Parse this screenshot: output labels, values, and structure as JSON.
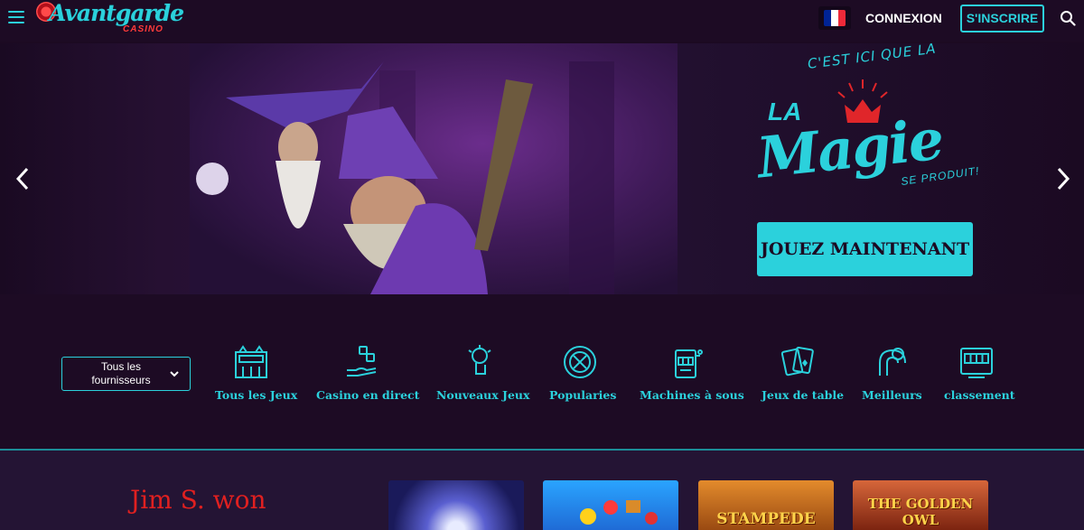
{
  "header": {
    "logo_text": "Avantgarde",
    "logo_sub": "CASINO",
    "login_label": "CONNEXION",
    "signup_label": "S'INSCRIRE",
    "flag_colors": [
      "#002395",
      "#ffffff",
      "#ed2939"
    ]
  },
  "hero": {
    "tagline": "C'EST ICI QUE LA",
    "la": "LA",
    "magie": "Magie",
    "produit": "SE PRODUIT!",
    "cta_label": "JOUEZ MAINTENANT",
    "accent": "#2bd1dc"
  },
  "filters": {
    "provider_label": "Tous les fournisseurs"
  },
  "categories": [
    {
      "label": "Tous les Jeux",
      "icon": "casino-building-icon"
    },
    {
      "label": "Casino en direct",
      "icon": "dealer-hand-dice-icon"
    },
    {
      "label": "Nouveaux Jeux",
      "icon": "new-games-icon"
    },
    {
      "label": "Popularies",
      "icon": "roulette-wheel-icon"
    },
    {
      "label": "Machines à sous",
      "icon": "slot-machine-icon"
    },
    {
      "label": "Jeux de table",
      "icon": "playing-cards-icon"
    },
    {
      "label": "Meilleurs",
      "icon": "magnet-icon"
    },
    {
      "label": "classement",
      "icon": "leaderboard-slot-icon"
    }
  ],
  "winner": {
    "text": "Jim S. won"
  },
  "games": [
    {
      "label": ""
    },
    {
      "label": ""
    },
    {
      "label": "STAMPEDE"
    },
    {
      "label": "THE GOLDEN OWL"
    }
  ]
}
